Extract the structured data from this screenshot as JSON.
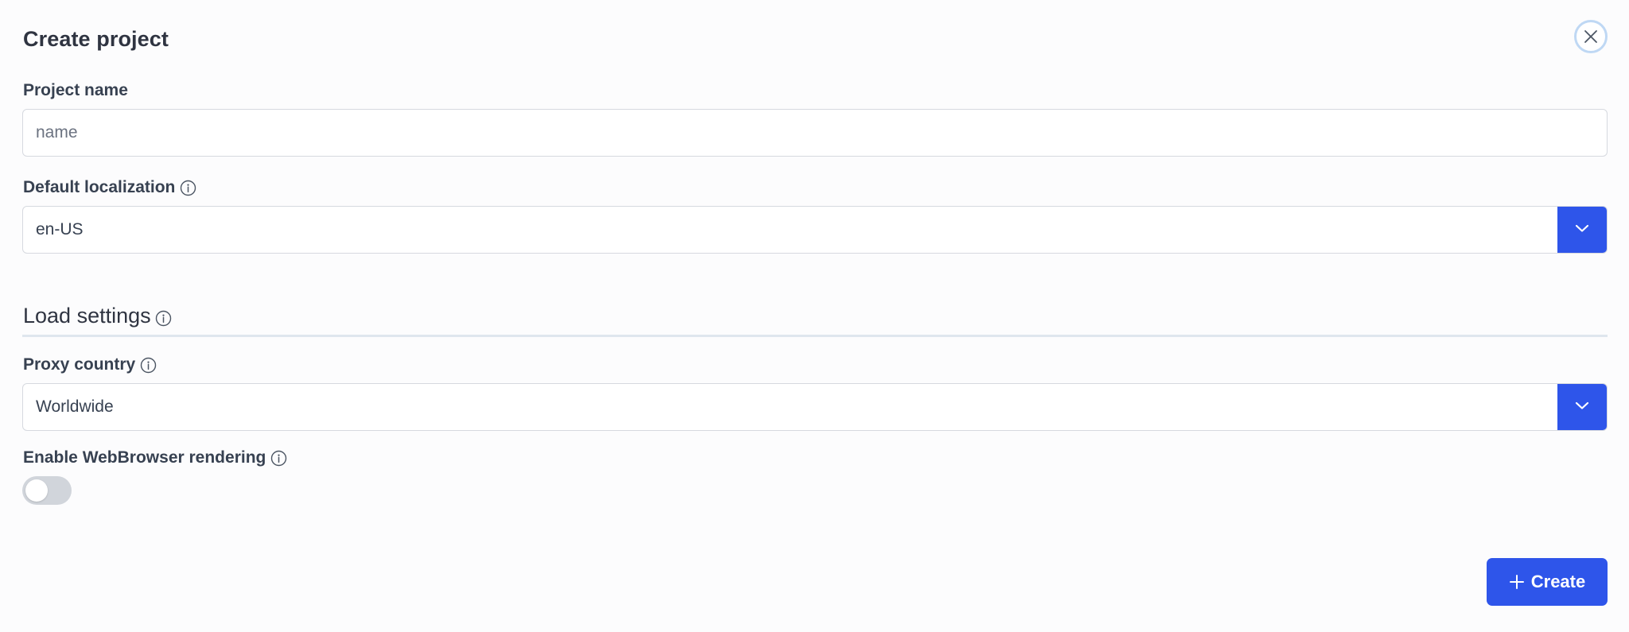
{
  "dialog": {
    "title": "Create project",
    "close_icon": "close-icon"
  },
  "project_name": {
    "label": "Project name",
    "placeholder": "name",
    "value": ""
  },
  "default_localization": {
    "label": "Default localization",
    "value": "en-US",
    "info_icon": "info-icon",
    "dropdown_icon": "chevron-down-icon"
  },
  "load_settings": {
    "title": "Load settings",
    "info_icon": "info-icon"
  },
  "proxy_country": {
    "label": "Proxy country",
    "value": "Worldwide",
    "info_icon": "info-icon",
    "dropdown_icon": "chevron-down-icon"
  },
  "webbrowser_rendering": {
    "label": "Enable WebBrowser rendering",
    "enabled": false,
    "info_icon": "info-icon"
  },
  "actions": {
    "create_label": "Create",
    "create_icon": "plus-icon"
  },
  "colors": {
    "accent": "#2e55ea",
    "text": "#374151",
    "border": "#d6d9df",
    "toggle_off": "#d1d5db",
    "close_ring": "#bfd8f4"
  }
}
